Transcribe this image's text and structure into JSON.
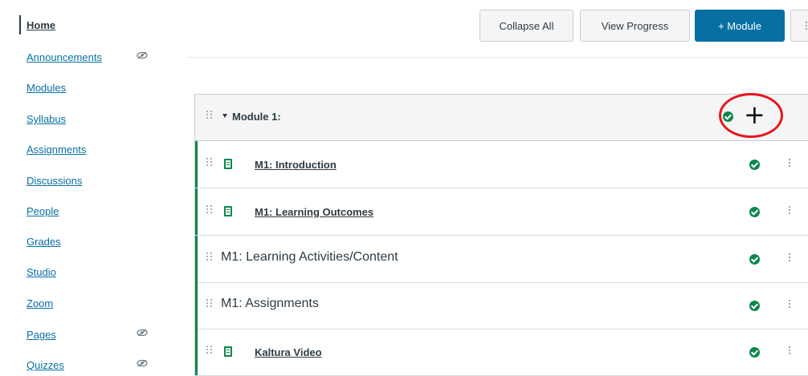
{
  "course_nav": {
    "items": [
      {
        "label": "Home",
        "active": true,
        "hidden": false
      },
      {
        "label": "Announcements",
        "active": false,
        "hidden": true
      },
      {
        "label": "Modules",
        "active": false,
        "hidden": false
      },
      {
        "label": "Syllabus",
        "active": false,
        "hidden": false
      },
      {
        "label": "Assignments",
        "active": false,
        "hidden": false
      },
      {
        "label": "Discussions",
        "active": false,
        "hidden": false
      },
      {
        "label": "People",
        "active": false,
        "hidden": false
      },
      {
        "label": "Grades",
        "active": false,
        "hidden": false
      },
      {
        "label": "Studio",
        "active": false,
        "hidden": false
      },
      {
        "label": "Zoom",
        "active": false,
        "hidden": false
      },
      {
        "label": "Pages",
        "active": false,
        "hidden": true
      },
      {
        "label": "Quizzes",
        "active": false,
        "hidden": true
      }
    ]
  },
  "header": {
    "collapse_all": "Collapse All",
    "view_progress": "View Progress",
    "add_module": "+ Module"
  },
  "module": {
    "title": "Module 1:",
    "add_icon": "plus-icon",
    "items": [
      {
        "title": "M1: Introduction",
        "type": "page",
        "published": true
      },
      {
        "title": "M1: Learning Outcomes",
        "type": "page",
        "published": true
      },
      {
        "title": "M1: Learning Activities/Content",
        "type": "subheader",
        "published": true
      },
      {
        "title": "M1: Assignments",
        "type": "subheader",
        "published": true
      },
      {
        "title": "Kaltura Video",
        "type": "page",
        "published": true
      }
    ]
  },
  "colors": {
    "link": "#0770a3",
    "published": "#0b874b",
    "primary_button": "#0770a3",
    "highlight": "#e8141c"
  }
}
